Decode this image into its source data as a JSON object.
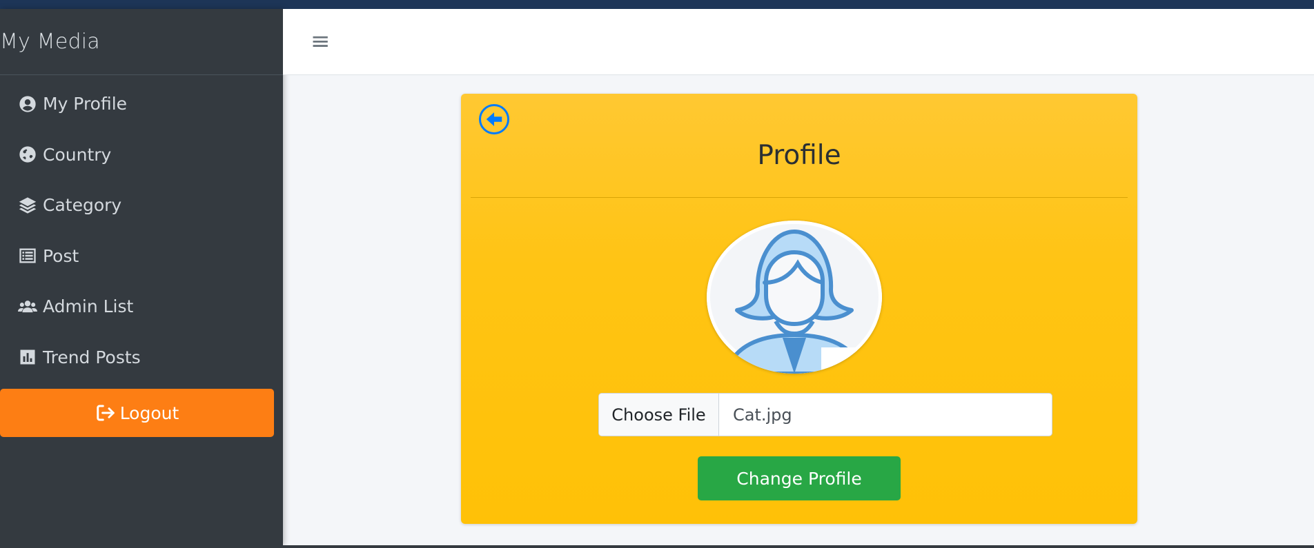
{
  "sidebar": {
    "brand": "My Media",
    "items": [
      {
        "label": "My Profile",
        "icon": "user-circle-icon"
      },
      {
        "label": "Country",
        "icon": "globe-icon"
      },
      {
        "label": "Category",
        "icon": "layers-icon"
      },
      {
        "label": "Post",
        "icon": "list-alt-icon"
      },
      {
        "label": "Admin List",
        "icon": "users-icon"
      },
      {
        "label": "Trend Posts",
        "icon": "chart-bar-icon"
      }
    ],
    "logout_label": "Logout"
  },
  "header": {
    "menu_icon": "≡"
  },
  "profile_card": {
    "title": "Profile",
    "back_icon": "arrow-circle-left-icon",
    "file_button_label": "Choose File",
    "file_name": "Cat.jpg",
    "submit_label": "Change Profile"
  },
  "colors": {
    "sidebar_bg": "#343a40",
    "logout_bg": "#fd7e14",
    "card_bg": "#ffc107",
    "submit_bg": "#28a745",
    "back_icon": "#007bff",
    "topbar": "#1d3557"
  }
}
